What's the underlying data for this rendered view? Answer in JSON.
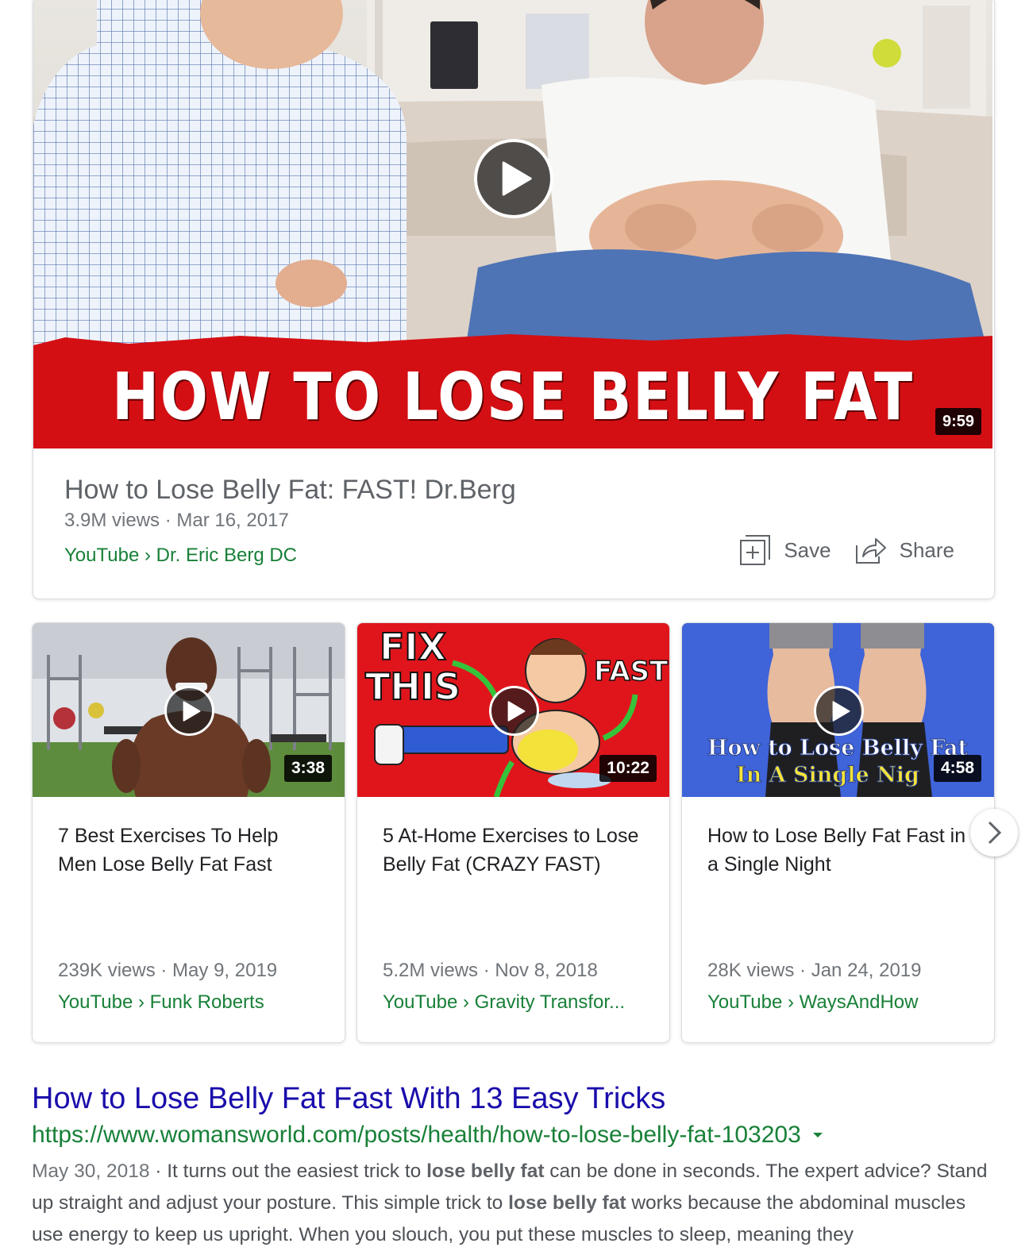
{
  "main_video": {
    "thumbnail_text": "HOW TO LOSE BELLY FAT",
    "duration": "9:59",
    "title": "How to Lose Belly Fat: FAST! Dr.Berg",
    "meta": "3.9M views · Mar 16, 2017",
    "source": "YouTube › Dr. Eric Berg DC",
    "save_label": "Save",
    "share_label": "Share"
  },
  "videos": [
    {
      "duration": "3:38",
      "title": "7 Best Exercises To Help Men Lose Belly Fat Fast",
      "meta": "239K views · May 9, 2019",
      "source": "YouTube › Funk Roberts"
    },
    {
      "duration": "10:22",
      "thumb_text_1": "FIX",
      "thumb_text_2": "THIS",
      "thumb_text_3": "FAST",
      "title": "5 At-Home Exercises to Lose Belly Fat (CRAZY FAST)",
      "meta": "5.2M views · Nov 8, 2018",
      "source": "YouTube › Gravity Transfor..."
    },
    {
      "duration": "4:58",
      "thumb_text_1": "How to Lose Belly Fat",
      "thumb_text_2": "In A Single Nig",
      "title": "How to Lose Belly Fat Fast in a Single Night",
      "meta": "28K views · Jan 24, 2019",
      "source": "YouTube › WaysAndHow"
    }
  ],
  "result": {
    "title": "How to Lose Belly Fat Fast With 13 Easy Tricks",
    "url": "https://www.womansworld.com/posts/health/how-to-lose-belly-fat-103203",
    "date": "May 30, 2018",
    "snippet_1": " · It turns out the easiest trick to ",
    "bold_1": "lose belly fat",
    "snippet_2": " can be done in seconds. The expert advice? Stand up straight and adjust your posture. This simple trick to ",
    "bold_2": "lose belly fat",
    "snippet_3": " works because the abdominal muscles use energy to keep us upright. When you slouch, you put these muscles to sleep, meaning they"
  },
  "colors": {
    "link": "#1a0dab",
    "url_green": "#188038",
    "banner_red": "#d40f14",
    "muted_text": "#70757a"
  },
  "icons": [
    "play-icon",
    "save-icon",
    "share-icon",
    "caret-down-icon",
    "chevron-right-icon"
  ]
}
